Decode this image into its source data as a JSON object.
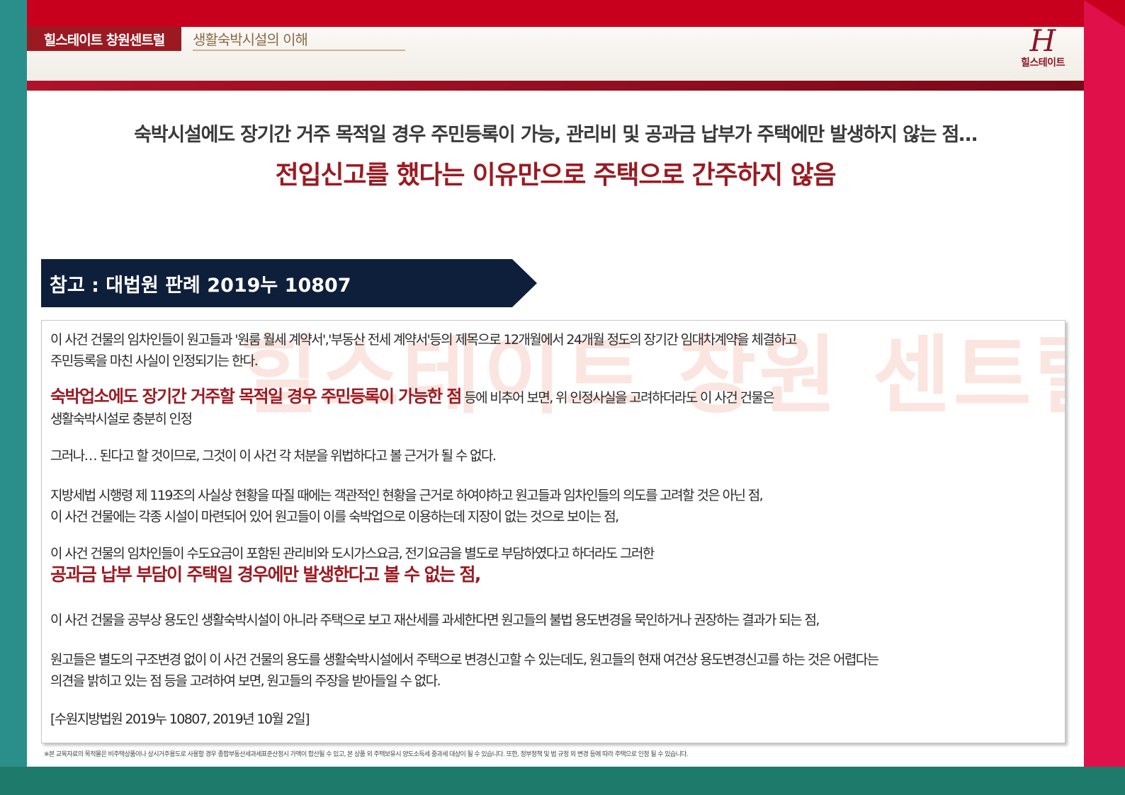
{
  "header": {
    "brand": "힐스테이트 창원센트럴",
    "section": "생활숙박시설의 이해",
    "logo_text": "힐스테이트",
    "logo_mark": "H"
  },
  "headline": {
    "line1": "숙박시설에도 장기간 거주 목적일 경우 주민등록이 가능, 관리비 및 공과금 납부가 주택에만 발생하지 않는 점…",
    "line2": "전입신고를 했다는 이유만으로 주택으로 간주하지 않음"
  },
  "reference": {
    "title": "참고 : 대법원 판례 2019누 10807"
  },
  "watermark": "힐스테이트 창원 센트럴",
  "body": {
    "p1_line1": "이 사건 건물의 임차인들이 원고들과 '원룸 월세 계약서','부동산 전세 계약서'등의 제목으로 12개월에서 24개월 정도의 장기간 임대차계약을 체결하고",
    "p1_line2": "주민등록을 마친 사실이 인정되기는 한다.",
    "p2_highlight": "숙박업소에도 장기간 거주할 목적일 경우 주민등록이 가능한 점",
    "p2_rest": " 등에 비추어 보면, 위 인정사실을 고려하더라도 이 사건 건물은",
    "p2_line2": "생활숙박시설로 충분히 인정",
    "p3": "그러나… 된다고 할 것이므로, 그것이 이 사건 각 처분을 위법하다고 볼 근거가 될 수 없다.",
    "p4_line1": "지방세법 시행령 제 119조의 사실상 현황을 따질 때에는 객관적인 현황을 근거로 하여야하고 원고들과 임차인들의 의도를 고려할 것은 아닌 점,",
    "p4_line2": "이 사건 건물에는 각종 시설이 마련되어 있어 원고들이 이를 숙박업으로 이용하는데 지장이 없는 것으로 보이는 점,",
    "p5_line1": "이 사건 건물의 임차인들이 수도요금이 포함된 관리비와 도시가스요금, 전기요금을 별도로 부담하였다고 하더라도 그러한",
    "p5_highlight": "공과금 납부 부담이 주택일 경우에만 발생한다고 볼 수 없는 점,",
    "p6": "이 사건 건물을 공부상 용도인 생활숙박시설이 아니라 주택으로 보고 재산세를 과세한다면 원고들의 불법 용도변경을 묵인하거나 권장하는 결과가 되는 점,",
    "p7_line1": "원고들은 별도의 구조변경 없이 이 사건 건물의 용도를 생활숙박시설에서 주택으로 변경신고할 수 있는데도, 원고들의 현재 여건상 용도변경신고를 하는 것은 어렵다는",
    "p7_line2": "의견을 밝히고 있는 점 등을 고려하여 보면, 원고들의 주장을 받아들일 수 없다.",
    "citation": "[수원지방법원 2019누 10807, 2019년 10월 2일]"
  },
  "footnote": "※본 교육자료의 목적물은 비주택상품이나 상시거주용도로 사용할 경우 종합부동산세과세표준산정시 가액이 합산될 수 있고, 본 상품 외 주택보유시 양도소득세 중과세 대상이 될 수 있습니다. 또한, 정부정책 및 법 규정 외 변경 등에 따라 주택으로 인정 될 수 있습니다.",
  "colors": {
    "accent": "#9b1a22",
    "navy": "#0e1f3c",
    "frame_top": "#c8001e",
    "frame_left": "#2a8f8b",
    "frame_right": "#e0104a",
    "frame_bottom": "#1e7a6a"
  }
}
